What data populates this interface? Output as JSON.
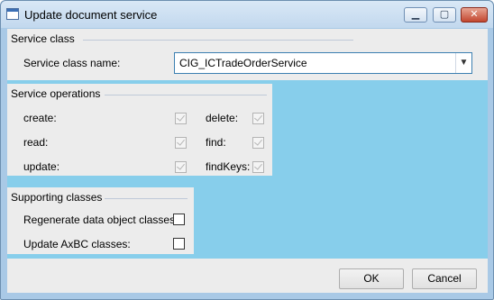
{
  "window": {
    "title": "Update document service",
    "controls": {
      "minimize": "▁",
      "maximize": "▢",
      "close": "✕"
    }
  },
  "service_class": {
    "group_title": "Service class",
    "name_label": "Service class name:",
    "name_value": "CIG_ICTradeOrderService"
  },
  "service_operations": {
    "group_title": "Service operations",
    "items": [
      {
        "label": "create:",
        "checked": true
      },
      {
        "label": "read:",
        "checked": true
      },
      {
        "label": "update:",
        "checked": true
      },
      {
        "label": "delete:",
        "checked": true
      },
      {
        "label": "find:",
        "checked": true
      },
      {
        "label": "findKeys:",
        "checked": true
      }
    ]
  },
  "supporting_classes": {
    "group_title": "Supporting classes",
    "items": [
      {
        "label": "Regenerate data object classes:",
        "checked": false
      },
      {
        "label": "Update AxBC classes:",
        "checked": false
      }
    ]
  },
  "buttons": {
    "ok": "OK",
    "cancel": "Cancel"
  },
  "colors": {
    "background": "#87ceeb",
    "panel": "#ececec",
    "combo_border": "#3c7fb1"
  }
}
